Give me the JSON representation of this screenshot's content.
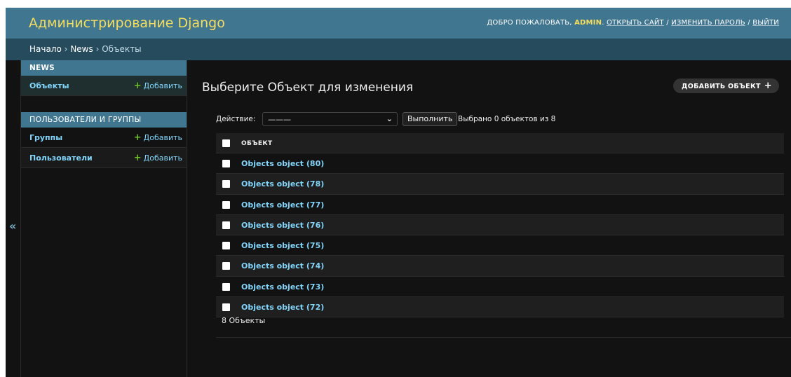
{
  "header": {
    "site_title": "Администрирование Django",
    "welcome": "ДОБРО ПОЖАЛОВАТЬ,",
    "username": "ADMIN",
    "links": [
      "ОТКРЫТЬ САЙТ",
      "ИЗМЕНИТЬ ПАРОЛЬ",
      "ВЫЙТИ"
    ],
    "separator": "/"
  },
  "breadcrumbs": {
    "items": [
      "Начало",
      "News",
      "Объекты"
    ],
    "separator": "›"
  },
  "sidebar": {
    "toggle_glyph": "«",
    "modules": [
      {
        "caption": "NEWS",
        "rows": [
          {
            "label": "Объекты",
            "add": "Добавить"
          }
        ]
      },
      {
        "caption": "ПОЛЬЗОВАТЕЛИ И ГРУППЫ",
        "rows": [
          {
            "label": "Группы",
            "add": "Добавить"
          },
          {
            "label": "Пользователи",
            "add": "Добавить"
          }
        ]
      }
    ]
  },
  "main": {
    "title": "Выберите Объект для изменения",
    "add_button": "ДОБАВИТЬ ОБЪЕКТ",
    "actions": {
      "label": "Действие:",
      "select_value": "———",
      "go": "Выполнить",
      "selection": "Выбрано 0 объектов из 8"
    },
    "table": {
      "header": "ОБЪЕКТ",
      "rows": [
        "Objects object (80)",
        "Objects object (78)",
        "Objects object (77)",
        "Objects object (76)",
        "Objects object (75)",
        "Objects object (74)",
        "Objects object (73)",
        "Objects object (72)"
      ]
    },
    "paginator": "8 Объекты"
  },
  "colors": {
    "header_bg": "#417690",
    "breadcrumb_bg": "#264b5d",
    "title_yellow": "#f5dd5d",
    "link_blue": "#81d4fa",
    "add_green": "#70bf2b",
    "page_bg": "#121212"
  }
}
